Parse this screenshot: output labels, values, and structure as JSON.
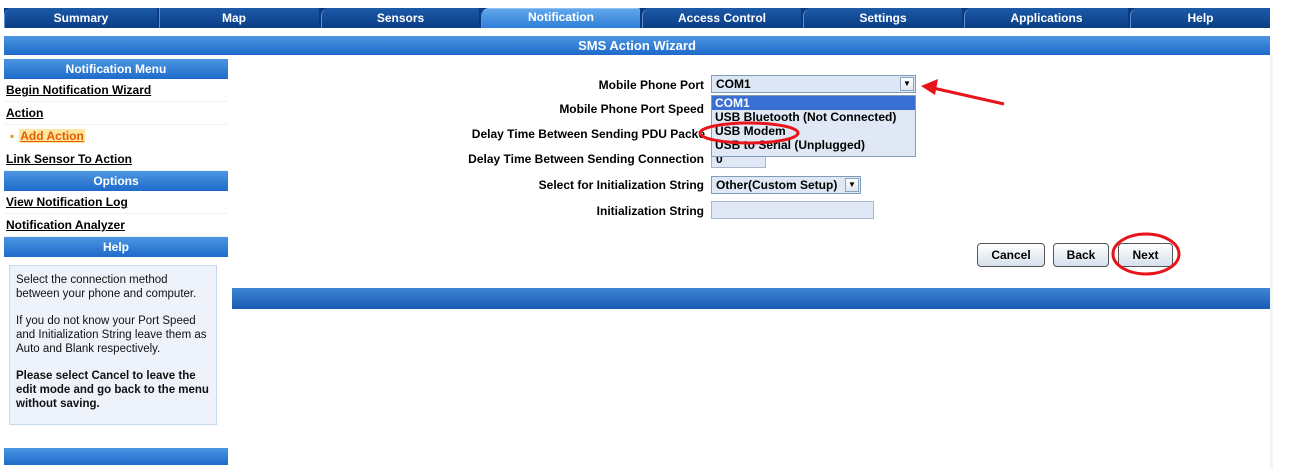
{
  "tabs": [
    {
      "label": "Summary"
    },
    {
      "label": "Map"
    },
    {
      "label": "Sensors"
    },
    {
      "label": "Notification",
      "active": true
    },
    {
      "label": "Access Control"
    },
    {
      "label": "Settings"
    },
    {
      "label": "Applications"
    },
    {
      "label": "Help"
    }
  ],
  "page_title": "SMS Action Wizard",
  "sidebar": {
    "notification_menu_header": "Notification Menu",
    "begin_wizard": "Begin Notification Wizard",
    "action": "Action",
    "add_action": "Add Action",
    "link_sensor": "Link Sensor To Action",
    "options_header": "Options",
    "view_log": "View Notification Log",
    "analyzer": "Notification Analyzer",
    "help_header": "Help",
    "help_text_1": "Select the connection method between your phone and computer.",
    "help_text_2": "If you do not know your Port Speed and Initialization String leave them as Auto and Blank respectively.",
    "help_text_3": "Please select Cancel to leave the edit mode and go back to the menu without saving."
  },
  "form": {
    "port_label": "Mobile Phone Port",
    "port_value": "COM1",
    "speed_label": "Mobile Phone Port Speed",
    "delay_pdu_label": "Delay Time Between Sending PDU Packe",
    "delay_conn_label": "Delay Time Between Sending Connection",
    "delay_conn_value": "0",
    "init_select_label": "Select for Initialization String",
    "init_select_value": "Other(Custom Setup)",
    "init_string_label": "Initialization String",
    "init_string_value": ""
  },
  "port_options": [
    "COM1",
    "USB Bluetooth (Not Connected)",
    "USB Modem",
    "USB to Serial (Unplugged)"
  ],
  "buttons": {
    "cancel": "Cancel",
    "back": "Back",
    "next": "Next"
  },
  "colors": {
    "annotation": "#e8141b",
    "tab_bar": "#0a3a80",
    "header_blue": "#1f6ac9"
  }
}
